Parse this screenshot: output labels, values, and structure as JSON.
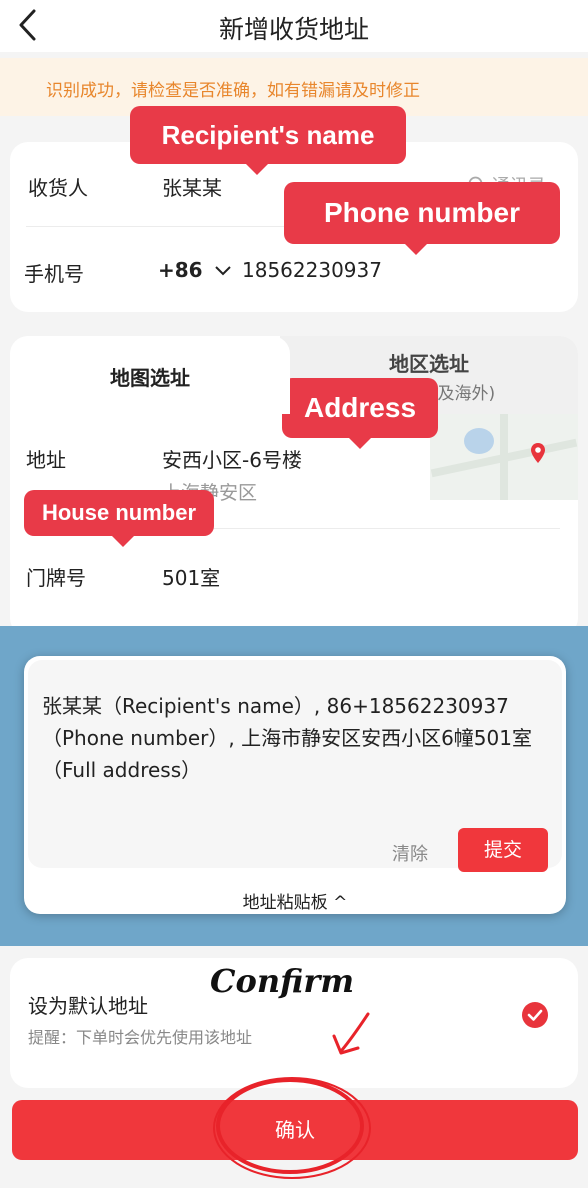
{
  "header": {
    "title": "新增收货地址"
  },
  "notice": {
    "text": "识别成功，请检查是否准确，如有错漏请及时修正"
  },
  "recipient": {
    "label": "收货人",
    "value": "张某某",
    "contacts": "通讯录"
  },
  "phone": {
    "label": "手机号",
    "country_code": "+86",
    "value": "18562230937"
  },
  "tabs": {
    "map": "地图选址",
    "region": "地区选址",
    "region_sub": "(含港澳台及海外)"
  },
  "address": {
    "label": "地址",
    "value": "安西小区-6号楼",
    "sub": "上海静安区"
  },
  "house": {
    "label": "门牌号",
    "value": "501室"
  },
  "paste": {
    "text": "张某某（Recipient's name）, 86+18562230937（Phone number）, 上海市静安区安西小区6幢501室（Full address）",
    "clear": "清除",
    "submit": "提交",
    "clipboard_label": "地址粘贴板 ^"
  },
  "default": {
    "title": "设为默认地址",
    "tip": "提醒：下单时会优先使用该地址"
  },
  "confirm": {
    "label": "确认"
  },
  "annotations": {
    "recipient_name": "Recipient's name",
    "phone_number": "Phone number",
    "address": "Address",
    "house_number": "House number",
    "confirm": "Confirm"
  },
  "colors": {
    "accent": "#f0373c",
    "notice_text": "#e8862c",
    "panel_bg": "#6fa6c9"
  }
}
